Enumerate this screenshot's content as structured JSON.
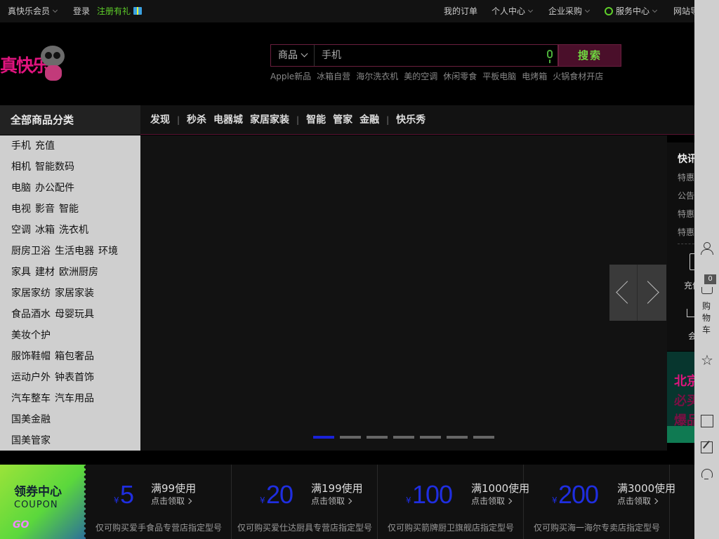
{
  "topbar": {
    "member": "真快乐会员",
    "login": "登录",
    "register": "注册有礼",
    "orders": "我的订单",
    "personal": "个人中心",
    "enterprise": "企业采购",
    "service": "服务中心",
    "sitenav": "网站导"
  },
  "logo": {
    "text": "真快乐"
  },
  "search": {
    "category": "商品",
    "placeholder": "手机",
    "button": "搜索",
    "hotwords": [
      "Apple新品",
      "冰箱自营",
      "海尔洗衣机",
      "美的空调",
      "休闲零食",
      "平板电脑",
      "电烤箱",
      "火锅食材开店"
    ]
  },
  "nav": {
    "all_categories": "全部商品分类",
    "links": [
      "发现",
      "秒杀",
      "电器城",
      "家居家装",
      "智能",
      "管家",
      "金融",
      "快乐秀"
    ]
  },
  "categories": [
    [
      "手机",
      "充值"
    ],
    [
      "相机",
      "智能数码"
    ],
    [
      "电脑",
      "办公配件"
    ],
    [
      "电视",
      "影音",
      "智能"
    ],
    [
      "空调",
      "冰箱",
      "洗衣机"
    ],
    [
      "厨房卫浴",
      "生活电器",
      "环境"
    ],
    [
      "家具",
      "建材",
      "欧洲厨房"
    ],
    [
      "家居家纺",
      "家居家装"
    ],
    [
      "食品酒水",
      "母婴玩具"
    ],
    [
      "美妆个护"
    ],
    [
      "服饰鞋帽",
      "箱包奢品"
    ],
    [
      "运动户外",
      "钟表首饰"
    ],
    [
      "汽车整车",
      "汽车用品"
    ],
    [
      "国美金融"
    ],
    [
      "国美管家"
    ]
  ],
  "banner": {
    "slide_count": 7,
    "active_slide": 1
  },
  "infopanel": {
    "title": "快讯",
    "rows": [
      "特惠",
      "公告",
      "特惠",
      "特惠"
    ],
    "recharge_label": "充值",
    "member_label": "会员"
  },
  "promo": {
    "lines": [
      "北京",
      "必买",
      "爆品"
    ]
  },
  "sidebar": {
    "cart_count": "0",
    "cart_label": "购物车"
  },
  "coupon_center": {
    "title": "领券中心",
    "subtitle": "COUPON",
    "go": "GO"
  },
  "coupons": [
    {
      "yen": "¥",
      "amount": "5",
      "condition": "满99使用",
      "action": "点击领取",
      "note": "仅可购买爱手食品专营店指定型号"
    },
    {
      "yen": "¥",
      "amount": "20",
      "condition": "满199使用",
      "action": "点击领取",
      "note": "仅可购买爱仕达厨具专营店指定型号"
    },
    {
      "yen": "¥",
      "amount": "100",
      "condition": "满1000使用",
      "action": "点击领取",
      "note": "仅可购买箭牌厨卫旗舰店指定型号"
    },
    {
      "yen": "¥",
      "amount": "200",
      "condition": "满3000使用",
      "action": "点击领取",
      "note": "仅可购买海一海尔专卖店指定型号"
    },
    {
      "yen": "¥",
      "amount": "",
      "condition": "",
      "action": "",
      "note": "仅"
    }
  ],
  "colors": {
    "accent": "#e0147e",
    "coupon_blue": "#1f2ee0",
    "green": "#5fcf2a"
  }
}
